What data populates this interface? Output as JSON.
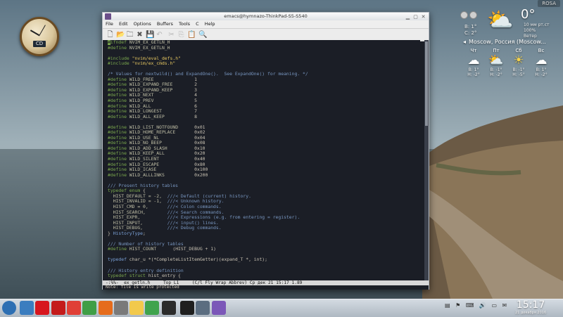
{
  "window": {
    "title": "emacs@hymnazo-ThinkPad-S5-S540",
    "menus": [
      "File",
      "Edit",
      "Options",
      "Buffers",
      "Tools",
      "C",
      "Help"
    ]
  },
  "editor": {
    "lines": [
      [
        [
          "cursor",
          "#"
        ],
        [
          "kw",
          "ifndef"
        ],
        [
          "mac",
          " NVIM_EX_GETLN_H"
        ]
      ],
      [
        [
          "kw",
          "#define"
        ],
        [
          "mac",
          " NVIM_EX_GETLN_H"
        ]
      ],
      [],
      [
        [
          "kw",
          "#include"
        ],
        [
          "str",
          " \"nvim/eval_defs.h\""
        ]
      ],
      [
        [
          "kw",
          "#include"
        ],
        [
          "str",
          " \"nvim/ex_cmds.h\""
        ]
      ],
      [],
      [
        [
          "com",
          "/* Values for nextwild() and ExpandOne().  See ExpandOne() for meaning. */"
        ]
      ],
      [
        [
          "kw",
          "#define"
        ],
        [
          "mac",
          " WILD_FREE"
        ],
        [
          "num",
          "               1"
        ]
      ],
      [
        [
          "kw",
          "#define"
        ],
        [
          "mac",
          " WILD_EXPAND_FREE"
        ],
        [
          "num",
          "        2"
        ]
      ],
      [
        [
          "kw",
          "#define"
        ],
        [
          "mac",
          " WILD_EXPAND_KEEP"
        ],
        [
          "num",
          "        3"
        ]
      ],
      [
        [
          "kw",
          "#define"
        ],
        [
          "mac",
          " WILD_NEXT"
        ],
        [
          "num",
          "               4"
        ]
      ],
      [
        [
          "kw",
          "#define"
        ],
        [
          "mac",
          " WILD_PREV"
        ],
        [
          "num",
          "               5"
        ]
      ],
      [
        [
          "kw",
          "#define"
        ],
        [
          "mac",
          " WILD_ALL"
        ],
        [
          "num",
          "                6"
        ]
      ],
      [
        [
          "kw",
          "#define"
        ],
        [
          "mac",
          " WILD_LONGEST"
        ],
        [
          "num",
          "            7"
        ]
      ],
      [
        [
          "kw",
          "#define"
        ],
        [
          "mac",
          " WILD_ALL_KEEP"
        ],
        [
          "num",
          "           8"
        ]
      ],
      [],
      [
        [
          "kw",
          "#define"
        ],
        [
          "mac",
          " WILD_LIST_NOTFOUND"
        ],
        [
          "num",
          "      0x01"
        ]
      ],
      [
        [
          "kw",
          "#define"
        ],
        [
          "mac",
          " WILD_HOME_REPLACE"
        ],
        [
          "num",
          "       0x02"
        ]
      ],
      [
        [
          "kw",
          "#define"
        ],
        [
          "mac",
          " WILD_USE_NL"
        ],
        [
          "num",
          "             0x04"
        ]
      ],
      [
        [
          "kw",
          "#define"
        ],
        [
          "mac",
          " WILD_NO_BEEP"
        ],
        [
          "num",
          "            0x08"
        ]
      ],
      [
        [
          "kw",
          "#define"
        ],
        [
          "mac",
          " WILD_ADD_SLASH"
        ],
        [
          "num",
          "          0x10"
        ]
      ],
      [
        [
          "kw",
          "#define"
        ],
        [
          "mac",
          " WILD_KEEP_ALL"
        ],
        [
          "num",
          "           0x20"
        ]
      ],
      [
        [
          "kw",
          "#define"
        ],
        [
          "mac",
          " WILD_SILENT"
        ],
        [
          "num",
          "             0x40"
        ]
      ],
      [
        [
          "kw",
          "#define"
        ],
        [
          "mac",
          " WILD_ESCAPE"
        ],
        [
          "num",
          "             0x80"
        ]
      ],
      [
        [
          "kw",
          "#define"
        ],
        [
          "mac",
          " WILD_ICASE"
        ],
        [
          "num",
          "              0x100"
        ]
      ],
      [
        [
          "kw",
          "#define"
        ],
        [
          "mac",
          " WILD_ALLLINKS"
        ],
        [
          "num",
          "           0x200"
        ]
      ],
      [],
      [
        [
          "com",
          "/// Present history tables"
        ]
      ],
      [
        [
          "kw",
          "typedef enum"
        ],
        [
          "num",
          " {"
        ]
      ],
      [
        [
          "mac",
          "  HIST_DEFAULT = -2,"
        ],
        [
          "com",
          "  ///< Default (current) history."
        ]
      ],
      [
        [
          "mac",
          "  HIST_INVALID = -1,"
        ],
        [
          "com",
          "  ///< Unknown history."
        ]
      ],
      [
        [
          "mac",
          "  HIST_CMD = 0,"
        ],
        [
          "com",
          "       ///< Colon commands."
        ]
      ],
      [
        [
          "mac",
          "  HIST_SEARCH,"
        ],
        [
          "com",
          "        ///< Search commands."
        ]
      ],
      [
        [
          "mac",
          "  HIST_EXPR,"
        ],
        [
          "com",
          "          ///< Expressions (e.g. from entering = register)."
        ]
      ],
      [
        [
          "mac",
          "  HIST_INPUT,"
        ],
        [
          "com",
          "         ///< input() lines."
        ]
      ],
      [
        [
          "mac",
          "  HIST_DEBUG,"
        ],
        [
          "com",
          "         ///< Debug commands."
        ]
      ],
      [
        [
          "num",
          "} "
        ],
        [
          "ty",
          "HistoryType"
        ],
        [
          "num",
          ";"
        ]
      ],
      [],
      [
        [
          "com",
          "/// Number of history tables"
        ]
      ],
      [
        [
          "kw",
          "#define"
        ],
        [
          "mac",
          " HIST_COUNT"
        ],
        [
          "num",
          "      (HIST_DEBUG + 1)"
        ]
      ],
      [],
      [
        [
          "ty",
          "typedef"
        ],
        [
          "num",
          " char_u *(*CompleteListItemGetter)(expand_T *, int);"
        ]
      ],
      [],
      [
        [
          "com",
          "/// History entry definition"
        ]
      ],
      [
        [
          "kw",
          "typedef struct"
        ],
        [
          "num",
          " hist_entry {"
        ]
      ]
    ]
  },
  "modeline": "-:%%-  ex_getln.h     Top L1     (C/l Fly Wrap Abbrev) Ср дек 21 15:17 1.89",
  "echo": "Note: file is write protected",
  "weather": {
    "rosa_label": "ROSA",
    "current_temp": "0°",
    "wind_lines": [
      "В: 1°",
      "С: 2°"
    ],
    "details": [
      "10 мм рт.ст",
      "100%",
      "Ветер"
    ],
    "location": "Moscow, Россия (Moscow...",
    "days": [
      {
        "name": "Чт",
        "icon": "☁",
        "l1": "В: 1°",
        "l2": "Н: -2°"
      },
      {
        "name": "Пт",
        "icon": "⛅",
        "l1": "В: -1°",
        "l2": "Н: -2°"
      },
      {
        "name": "Сб",
        "icon": "☀",
        "l1": "В: -1°",
        "l2": "Н: -5°"
      },
      {
        "name": "Вс",
        "icon": "☁",
        "l1": "В: 1°",
        "l2": "Н: -2°"
      }
    ]
  },
  "clock_widget": {
    "label": "CD"
  },
  "taskbar": {
    "time": "15:17",
    "date": "21 декабря 2016",
    "icons": [
      {
        "name": "start-menu-icon",
        "color": "#2d6fb3"
      },
      {
        "name": "file-manager-icon",
        "color": "#3b7dbf"
      },
      {
        "name": "opera-icon",
        "color": "#d7161e"
      },
      {
        "name": "opera-gx-icon",
        "color": "#c41b1b"
      },
      {
        "name": "vivaldi-icon",
        "color": "#e03f36"
      },
      {
        "name": "chrome-icon",
        "color": "#3f9e46"
      },
      {
        "name": "firefox-icon",
        "color": "#e66c1c"
      },
      {
        "name": "code-editor-icon",
        "color": "#7a7a7a"
      },
      {
        "name": "notes-icon",
        "color": "#f2c94c"
      },
      {
        "name": "app-green-icon",
        "color": "#3fa34d"
      },
      {
        "name": "terminal-icon",
        "color": "#2b2b2b"
      },
      {
        "name": "terminal-alt-icon",
        "color": "#1f1f1f"
      },
      {
        "name": "screenshot-icon",
        "color": "#5b6d80"
      },
      {
        "name": "emacs-icon",
        "color": "#7b57b8"
      }
    ]
  },
  "colors": {
    "editor_bg": "#1b1e26",
    "keyword": "#7ba84d",
    "comment": "#7896c0",
    "string": "#e6c760"
  }
}
